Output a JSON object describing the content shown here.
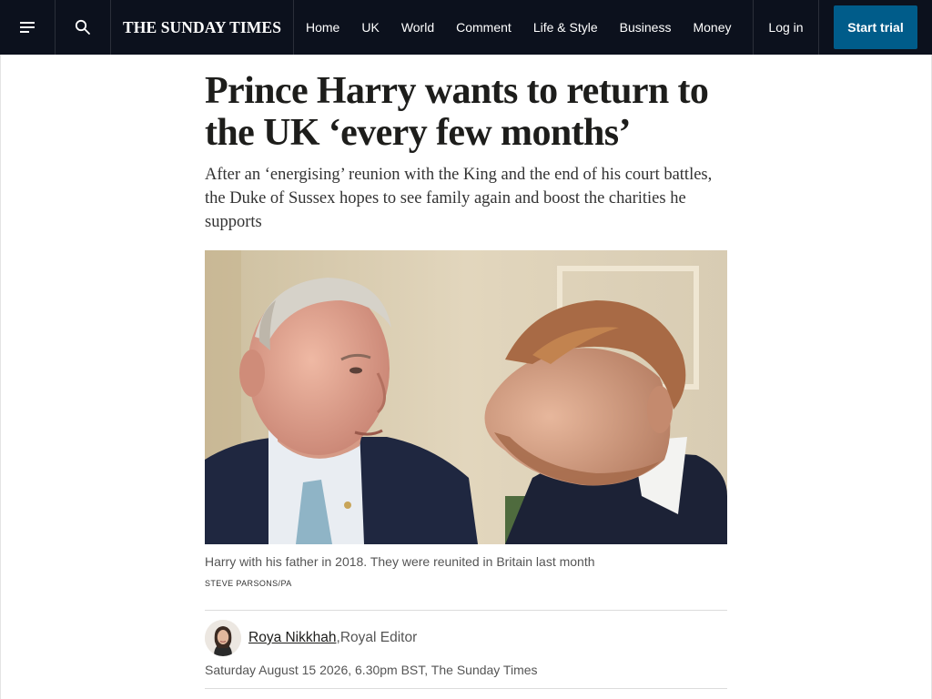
{
  "header": {
    "brand": "THE SUNDAY TIMES",
    "menu_icon": "hamburger-menu-icon",
    "search_icon": "search-icon",
    "nav": [
      {
        "label": "Home"
      },
      {
        "label": "UK"
      },
      {
        "label": "World"
      },
      {
        "label": "Comment"
      },
      {
        "label": "Life & Style"
      },
      {
        "label": "Business"
      },
      {
        "label": "Money"
      }
    ],
    "login_label": "Log in",
    "trial_label": "Start trial"
  },
  "article": {
    "headline": "Prince Harry wants to return to the UK ‘every few months’",
    "standfirst": "After an ‘energising’ reunion with the King and the end of his court battles, the Duke of Sussex hopes to see family again and boost the charities he supports",
    "image": {
      "caption": "Harry with his father in 2018. They were reunited in Britain last month",
      "credit": "STEVE PARSONS/PA"
    },
    "byline": {
      "author": "Roya Nikkhah",
      "separator": ",",
      "role": " Royal Editor"
    },
    "dateline": "Saturday August 15 2026, 6.30pm BST, The Sunday Times"
  },
  "colors": {
    "header_bg": "#0c111d",
    "trial_button": "#005c8a",
    "text": "#1d1d1b",
    "muted_text": "#555555"
  }
}
